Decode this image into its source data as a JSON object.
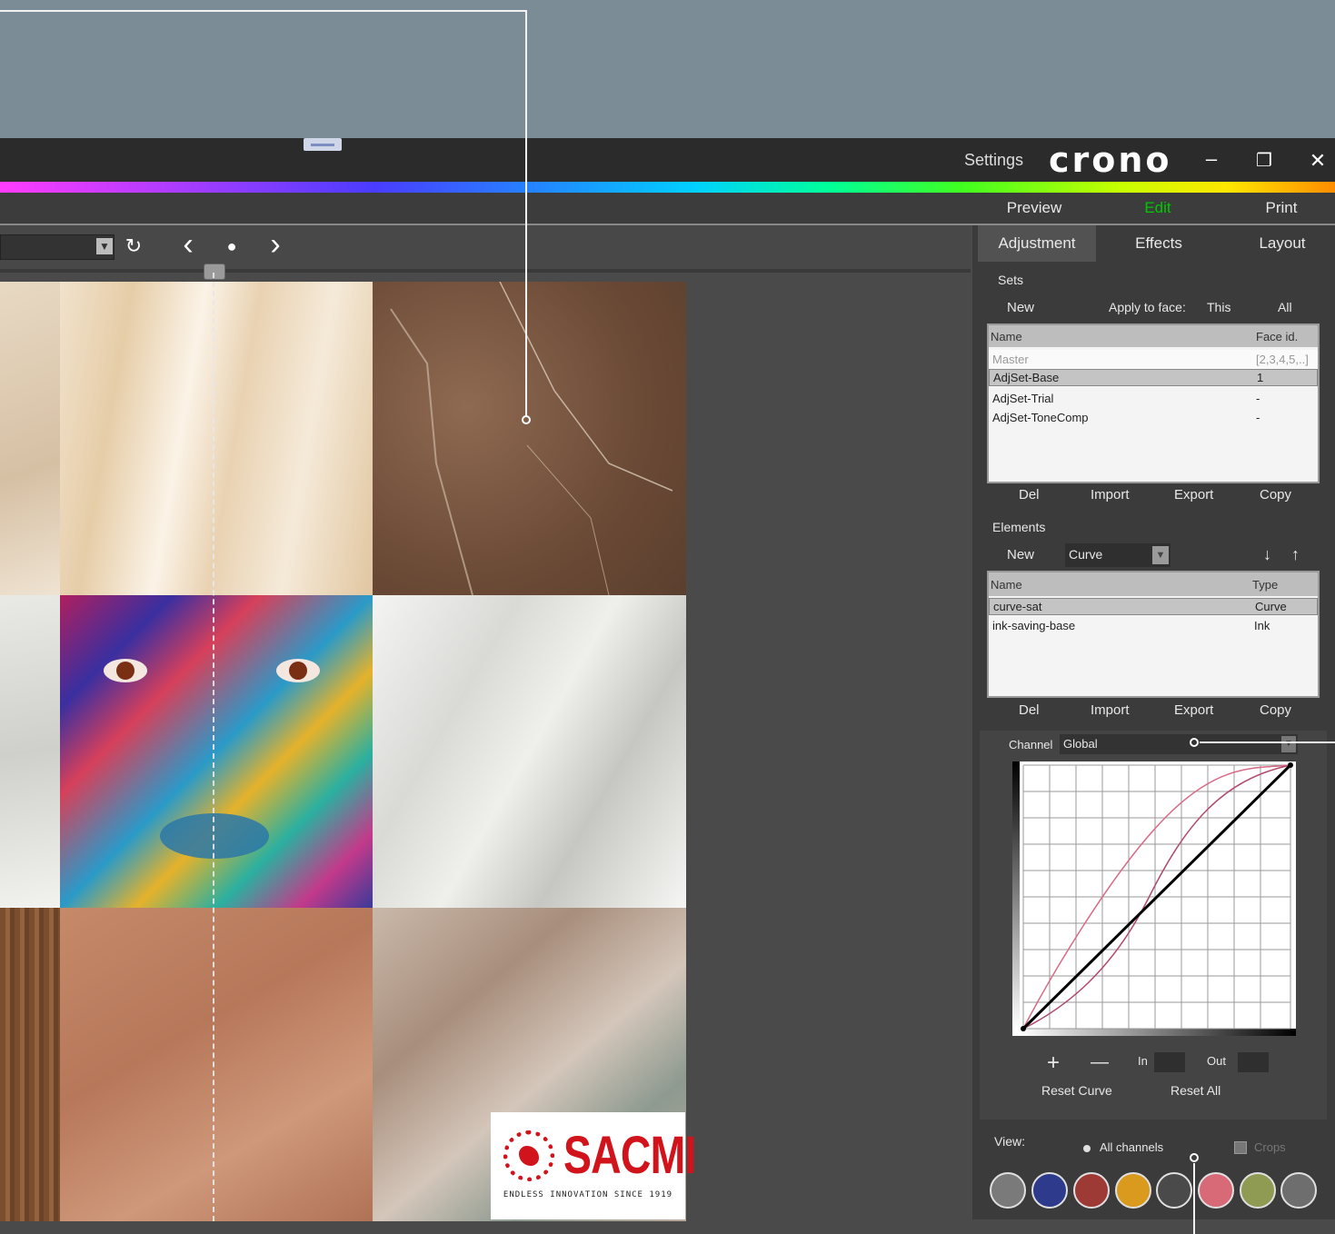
{
  "titlebar": {
    "settings_label": "Settings",
    "logo_text": "crono",
    "minimize_glyph": "–",
    "restore_glyph": "❐",
    "close_glyph": "✕"
  },
  "modes": {
    "preview": "Preview",
    "edit": "Edit",
    "print": "Print"
  },
  "colors": {
    "accent_edit": "#00c800",
    "brand_red": "#d1131b"
  },
  "toolbar": {
    "refresh_icon": "↻",
    "prev_icon": "‹",
    "dot_icon": "●",
    "next_icon": "›"
  },
  "panel": {
    "tabs": [
      "Adjustment",
      "Effects",
      "Layout"
    ],
    "sets": {
      "title": "Sets",
      "new_label": "New",
      "apply_label": "Apply to face:",
      "this_label": "This",
      "all_label": "All",
      "columns": [
        "Name",
        "Face id."
      ],
      "rows": [
        {
          "name": "Master",
          "face": "[2,3,4,5,..]"
        },
        {
          "name": "AdjSet-Base",
          "face": "1"
        },
        {
          "name": "AdjSet-Trial",
          "face": "-"
        },
        {
          "name": "AdjSet-ToneComp",
          "face": "-"
        }
      ],
      "buttons": [
        "Del",
        "Import",
        "Export",
        "Copy"
      ]
    },
    "elements": {
      "title": "Elements",
      "new_label": "New",
      "type_value": "Curve",
      "down_icon": "↓",
      "up_icon": "↑",
      "columns": [
        "Name",
        "Type"
      ],
      "rows": [
        {
          "name": "curve-sat",
          "type": "Curve"
        },
        {
          "name": "ink-saving-base",
          "type": "Ink"
        }
      ],
      "buttons": [
        "Del",
        "Import",
        "Export",
        "Copy"
      ]
    },
    "curve": {
      "channel_label": "Channel",
      "channel_value": "Global",
      "plus": "+",
      "minus": "—",
      "in_label": "In",
      "out_label": "Out",
      "reset_curve": "Reset Curve",
      "reset_all": "Reset All"
    },
    "view": {
      "label": "View:",
      "all_channels": "All channels",
      "crops": "Crops",
      "channel_colors": [
        "#7a7a7a",
        "#2e3a8c",
        "#9e3a36",
        "#d99a1e",
        "#4a4a4a",
        "#d86a78",
        "#8f9a52",
        "#6e6e6e"
      ]
    }
  },
  "sacmi": {
    "word": "SACMI",
    "tagline": "ENDLESS INNOVATION SINCE 1919"
  }
}
